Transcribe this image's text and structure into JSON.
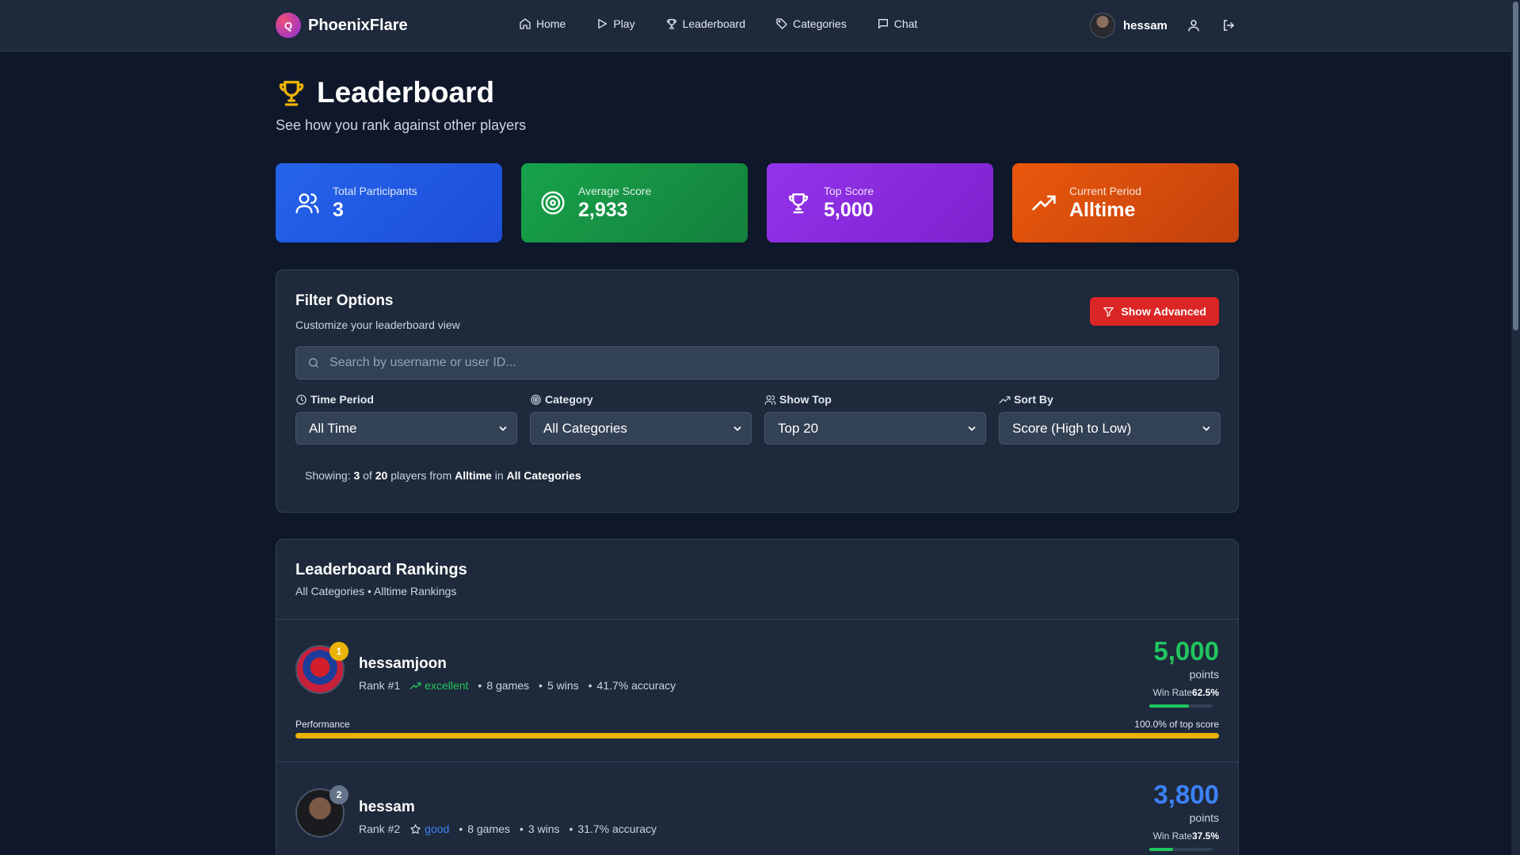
{
  "nav": {
    "brand_letter": "Q",
    "brand_name": "PhoenixFlare",
    "links": [
      {
        "label": "Home",
        "icon": "home-icon"
      },
      {
        "label": "Play",
        "icon": "play-icon"
      },
      {
        "label": "Leaderboard",
        "icon": "trophy-icon"
      },
      {
        "label": "Categories",
        "icon": "tag-icon"
      },
      {
        "label": "Chat",
        "icon": "chat-icon"
      }
    ],
    "username": "hessam"
  },
  "header": {
    "title": "Leaderboard",
    "subtitle": "See how you rank against other players"
  },
  "stats": [
    {
      "label": "Total Participants",
      "value": "3",
      "color": "#2563eb",
      "icon": "users-icon"
    },
    {
      "label": "Average Score",
      "value": "2,933",
      "color": "#16a34a",
      "icon": "target-icon"
    },
    {
      "label": "Top Score",
      "value": "5,000",
      "color": "#9333ea",
      "icon": "trophy-icon"
    },
    {
      "label": "Current Period",
      "value": "Alltime",
      "color": "#ea580c",
      "icon": "trending-up-icon"
    }
  ],
  "filters": {
    "title": "Filter Options",
    "subtitle": "Customize your leaderboard view",
    "advanced_label": "Show Advanced",
    "search_placeholder": "Search by username or user ID...",
    "groups": [
      {
        "label": "Time Period",
        "value": "All Time",
        "icon": "clock-icon"
      },
      {
        "label": "Category",
        "value": "All Categories",
        "icon": "target-icon"
      },
      {
        "label": "Show Top",
        "value": "Top 20",
        "icon": "users-icon"
      },
      {
        "label": "Sort By",
        "value": "Score (High to Low)",
        "icon": "trending-up-icon"
      }
    ],
    "showing": {
      "prefix": "Showing:",
      "count": "3",
      "of": "of",
      "total": "20",
      "players_from": "players from",
      "period": "Alltime",
      "in": "in",
      "category": "All Categories"
    }
  },
  "rankings": {
    "title": "Leaderboard Rankings",
    "subtitle": "All Categories • Alltime Rankings",
    "players": [
      {
        "name": "hessamjoon",
        "rank_badge": "1",
        "rank_text": "Rank #1",
        "tier": "excellent",
        "tier_color": "#22c55e",
        "tier_icon": "trending-up-icon",
        "games": "8 games",
        "wins": "5 wins",
        "accuracy": "41.7% accuracy",
        "score": "5,000",
        "score_color": "#22c55e",
        "points_label": "points",
        "win_rate_label": "Win Rate",
        "win_rate": "62.5%",
        "win_rate_value": 62.5,
        "performance_label": "Performance",
        "performance_text": "100.0% of top score",
        "performance_value": 100.0,
        "badge_color": "#eab308"
      },
      {
        "name": "hessam",
        "rank_badge": "2",
        "rank_text": "Rank #2",
        "tier": "good",
        "tier_color": "#3b82f6",
        "tier_icon": "star-icon",
        "games": "8 games",
        "wins": "3 wins",
        "accuracy": "31.7% accuracy",
        "score": "3,800",
        "score_color": "#3b82f6",
        "points_label": "points",
        "win_rate_label": "Win Rate",
        "win_rate": "37.5%",
        "win_rate_value": 37.5,
        "badge_color": "#64748b"
      }
    ]
  }
}
